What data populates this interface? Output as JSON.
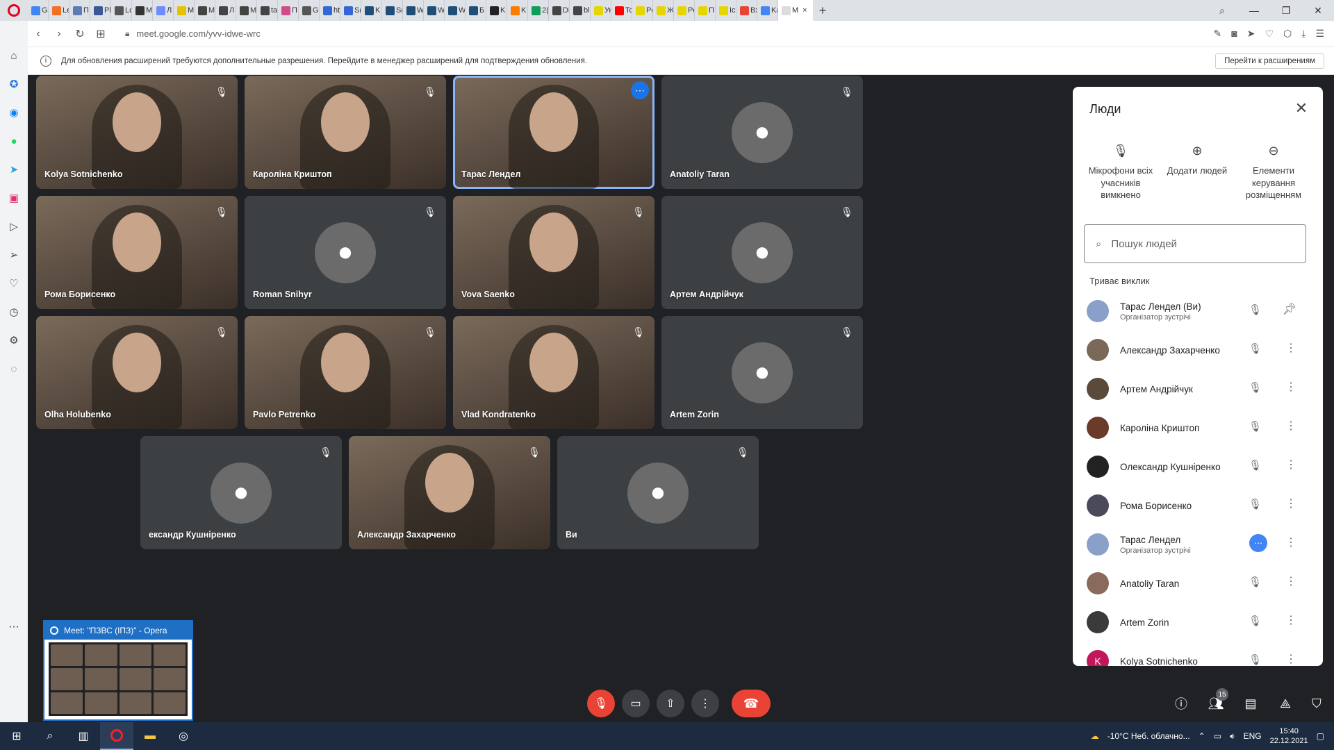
{
  "browser": {
    "tabs": [
      {
        "label": "G",
        "color": "#4285f4"
      },
      {
        "label": "Le",
        "color": "#f37021"
      },
      {
        "label": "П",
        "color": "#5b7db1"
      },
      {
        "label": "Pl",
        "color": "#3b5998"
      },
      {
        "label": "Lc",
        "color": "#555555"
      },
      {
        "label": "M",
        "color": "#333333"
      },
      {
        "label": "Л",
        "color": "#6f8cff"
      },
      {
        "label": "M",
        "color": "#e6c300"
      },
      {
        "label": "M",
        "color": "#444444"
      },
      {
        "label": "Л",
        "color": "#444444"
      },
      {
        "label": "M",
        "color": "#444444"
      },
      {
        "label": "ta",
        "color": "#444444"
      },
      {
        "label": "П",
        "color": "#d04b8a"
      },
      {
        "label": "Gl",
        "color": "#555555"
      },
      {
        "label": "ht",
        "color": "#3367d6"
      },
      {
        "label": "S(",
        "color": "#3367d6"
      },
      {
        "label": "K",
        "color": "#1f4e79"
      },
      {
        "label": "S(",
        "color": "#1f4e79"
      },
      {
        "label": "W",
        "color": "#1f4e79"
      },
      {
        "label": "W",
        "color": "#1f4e79"
      },
      {
        "label": "W",
        "color": "#1f4e79"
      },
      {
        "label": "Б",
        "color": "#1f4e79"
      },
      {
        "label": "K",
        "color": "#222222"
      },
      {
        "label": "K",
        "color": "#ff7a00"
      },
      {
        "label": "2(",
        "color": "#0f9d58"
      },
      {
        "label": "Di",
        "color": "#444444"
      },
      {
        "label": "bl",
        "color": "#444444"
      },
      {
        "label": "Ук",
        "color": "#e5d600"
      },
      {
        "label": "Tc",
        "color": "#ff0000"
      },
      {
        "label": "Pe",
        "color": "#e5d600"
      },
      {
        "label": "Ж",
        "color": "#e5d600"
      },
      {
        "label": "Pe",
        "color": "#e5d600"
      },
      {
        "label": "П",
        "color": "#e5d600"
      },
      {
        "label": "Ic",
        "color": "#e5d600"
      },
      {
        "label": "Вх",
        "color": "#ea4335"
      },
      {
        "label": "Ka",
        "color": "#4285f4"
      }
    ],
    "active_tab": "M",
    "url": "meet.google.com/yvv-idwe-wrc",
    "info_text": "Для обновления расширений требуются дополнительные разрешения. Перейдите в менеджер расширений для подтверждения обновления.",
    "info_button": "Перейти к расширениям"
  },
  "tiles": [
    {
      "name": "Kolya Sotnichenko",
      "kind": "video"
    },
    {
      "name": "Кароліна Криштоп",
      "kind": "video"
    },
    {
      "name": "Тарас Лендел",
      "kind": "video",
      "selected": true
    },
    {
      "name": "Anatoliy Taran",
      "kind": "avatar"
    },
    {
      "name": "Рома Борисенко",
      "kind": "video"
    },
    {
      "name": "Roman Snihyr",
      "kind": "avatar"
    },
    {
      "name": "Vova Saenko",
      "kind": "video"
    },
    {
      "name": "Артем Андрійчук",
      "kind": "avatar"
    },
    {
      "name": "Olha Holubenko",
      "kind": "video"
    },
    {
      "name": "Pavlo Petrenko",
      "kind": "video"
    },
    {
      "name": "Vlad Kondratenko",
      "kind": "video"
    },
    {
      "name": "Artem Zorin",
      "kind": "avatar"
    },
    {
      "name": "ександр Кушніренко",
      "kind": "avatar"
    },
    {
      "name": "Александр Захарченко",
      "kind": "video"
    },
    {
      "name": "Ви",
      "kind": "avatar"
    }
  ],
  "people_panel": {
    "title": "Люди",
    "actions": [
      {
        "label": "Мікрофони всіх учасників вимкнено",
        "icon": "mic-off-icon"
      },
      {
        "label": "Додати людей",
        "icon": "add-person-icon"
      },
      {
        "label": "Елементи керування розміщенням",
        "icon": "toggle-icon"
      }
    ],
    "search_placeholder": "Пошук людей",
    "section_label": "Триває виклик",
    "participants": [
      {
        "name": "Тарас Лендел (Ви)",
        "sub": "Організатор зустрічі",
        "action": "pin"
      },
      {
        "name": "Александр Захарченко",
        "sub": "",
        "action": "more"
      },
      {
        "name": "Артем Андрійчук",
        "sub": "",
        "action": "more"
      },
      {
        "name": "Кароліна Криштоп",
        "sub": "",
        "action": "more"
      },
      {
        "name": "Олександр Кушніренко",
        "sub": "",
        "action": "more"
      },
      {
        "name": "Рома Борисенко",
        "sub": "",
        "action": "more"
      },
      {
        "name": "Тарас Лендел",
        "sub": "Організатор зустрічі",
        "action": "more",
        "speaking": true
      },
      {
        "name": "Anatoliy Taran",
        "sub": "",
        "action": "more"
      },
      {
        "name": "Artem Zorin",
        "sub": "",
        "action": "more"
      },
      {
        "name": "Kolya Sotnichenko",
        "sub": "",
        "action": "more",
        "initial": "K"
      }
    ]
  },
  "controls": {
    "participants_count": "15"
  },
  "preview": {
    "title": "Meet: \"ПЗВС (ІПЗ)\" - Opera"
  },
  "taskbar": {
    "weather": "-10°C  Неб. облачно...",
    "lang": "ENG",
    "time": "15:40",
    "date": "22.12.2021"
  }
}
